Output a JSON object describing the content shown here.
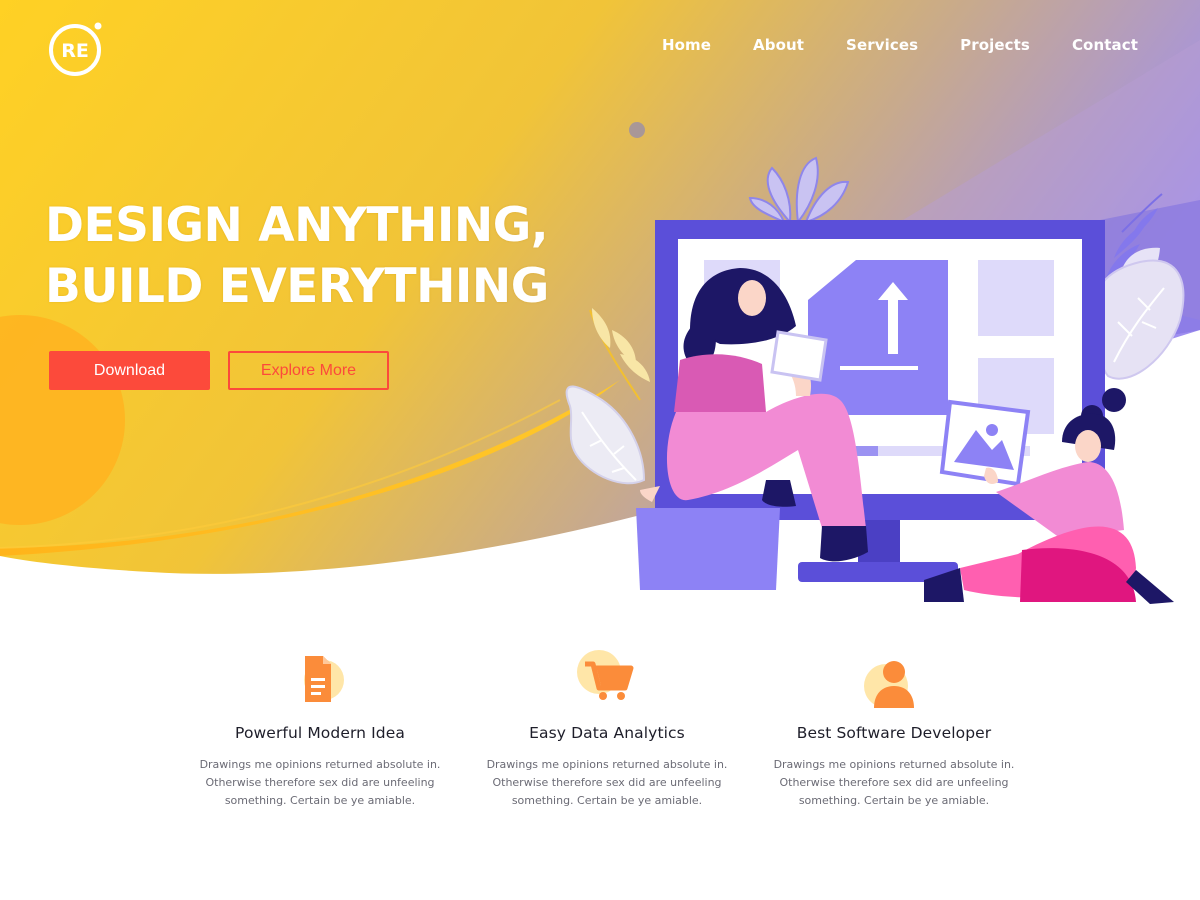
{
  "brand": {
    "logo_text": "RE",
    "accent": "#fc4a3b",
    "gradient_start": "#ffd124",
    "gradient_end": "#9f8ff0"
  },
  "nav": {
    "items": [
      {
        "label": "Home"
      },
      {
        "label": "About"
      },
      {
        "label": "Services"
      },
      {
        "label": "Projects"
      },
      {
        "label": "Contact"
      }
    ]
  },
  "hero": {
    "headline_line1": "DESIGN ANYTHING,",
    "headline_line2": "BUILD EVERYTHING",
    "download_label": "Download",
    "explore_label": "Explore More"
  },
  "features": [
    {
      "icon": "document-icon",
      "title": "Powerful Modern Idea",
      "text": "Drawings me opinions returned absolute in.\nOtherwise therefore sex did are unfeeling\nsomething. Certain be ye amiable."
    },
    {
      "icon": "cart-icon",
      "title": "Easy Data Analytics",
      "text": "Drawings me opinions returned absolute in.\nOtherwise therefore sex did are unfeeling\nsomething. Certain be ye amiable."
    },
    {
      "icon": "user-icon",
      "title": "Best Software Developer",
      "text": "Drawings me opinions returned absolute in.\nOtherwise therefore sex did are unfeeling\nsomething. Certain be ye amiable."
    }
  ]
}
